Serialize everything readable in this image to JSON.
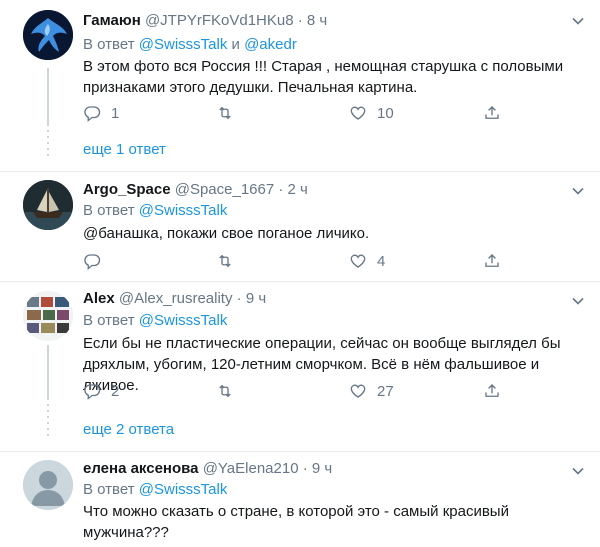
{
  "tweets": [
    {
      "name": "Гамаюн",
      "handle": "@JTPYrFKoVd1HKu8",
      "dot": "·",
      "time": "8 ч",
      "reply_prefix": "В ответ",
      "reply_users": [
        "@SwisssTalk",
        "@akedr"
      ],
      "reply_join": "и",
      "text": "В этом фото вся Россия !!! Старая , немощная старушка с половыми признаками этого дедушки. Печальная картина.",
      "replies": "1",
      "retweets": "",
      "likes": "10",
      "more": "еще 1 ответ"
    },
    {
      "name": "Argo_Space",
      "handle": "@Space_1667",
      "dot": "·",
      "time": "2 ч",
      "reply_prefix": "В ответ",
      "reply_users": [
        "@SwisssTalk"
      ],
      "text": "@банашка, покажи свое поганое личико.",
      "replies": "",
      "retweets": "",
      "likes": "4"
    },
    {
      "name": "Alex",
      "handle": "@Alex_rusreality",
      "dot": "·",
      "time": "9 ч",
      "reply_prefix": "В ответ",
      "reply_users": [
        "@SwisssTalk"
      ],
      "text": "Если бы не пластические операции, сейчас он вообще выглядел бы дряхлым, убогим, 120-летним сморчком. Всё в нём фальшивое и лживое.",
      "replies": "2",
      "retweets": "",
      "likes": "27",
      "more": "еще 2 ответа"
    },
    {
      "name": "елена аксенова",
      "handle": "@YaElena210",
      "dot": "·",
      "time": "9 ч",
      "reply_prefix": "В ответ",
      "reply_users": [
        "@SwisssTalk"
      ],
      "text": "Что можно сказать о стране, в которой это - самый красивый мужчина???"
    }
  ],
  "colors": {
    "link": "#1b95e0",
    "muted": "#657786",
    "text": "#14171a",
    "separator": "#e6ecf0"
  },
  "icons": [
    "reply-icon",
    "retweet-icon",
    "like-icon",
    "share-icon",
    "caret-down-icon"
  ]
}
